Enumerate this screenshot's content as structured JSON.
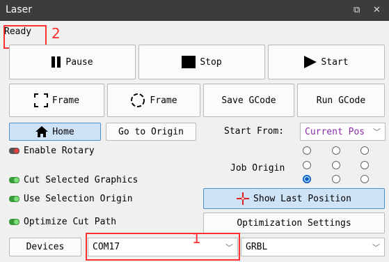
{
  "window": {
    "title": "Laser",
    "float_icon": "restore-icon",
    "close_icon": "close-icon"
  },
  "status": {
    "text": "Ready"
  },
  "annotations": {
    "one": "1",
    "two": "2"
  },
  "controls": {
    "pause": "Pause",
    "stop": "Stop",
    "start": "Start",
    "frame1": "Frame",
    "frame2": "Frame",
    "save_gcode": "Save GCode",
    "run_gcode": "Run GCode",
    "home": "Home",
    "go_to_origin": "Go to Origin",
    "start_from_label": "Start From:",
    "start_from_value": "Current Pos",
    "enable_rotary": "Enable Rotary",
    "job_origin_label": "Job Origin",
    "cut_selected": "Cut Selected Graphics",
    "use_selection_origin": "Use Selection Origin",
    "show_last_position": "Show Last Position",
    "optimize_cut_path": "Optimize Cut Path",
    "optimization_settings": "Optimization Settings",
    "devices": "Devices",
    "port_value": "COM17",
    "controller_value": "GRBL"
  },
  "colors": {
    "accent": "#4b8fd3",
    "annotation": "#ff3030"
  }
}
